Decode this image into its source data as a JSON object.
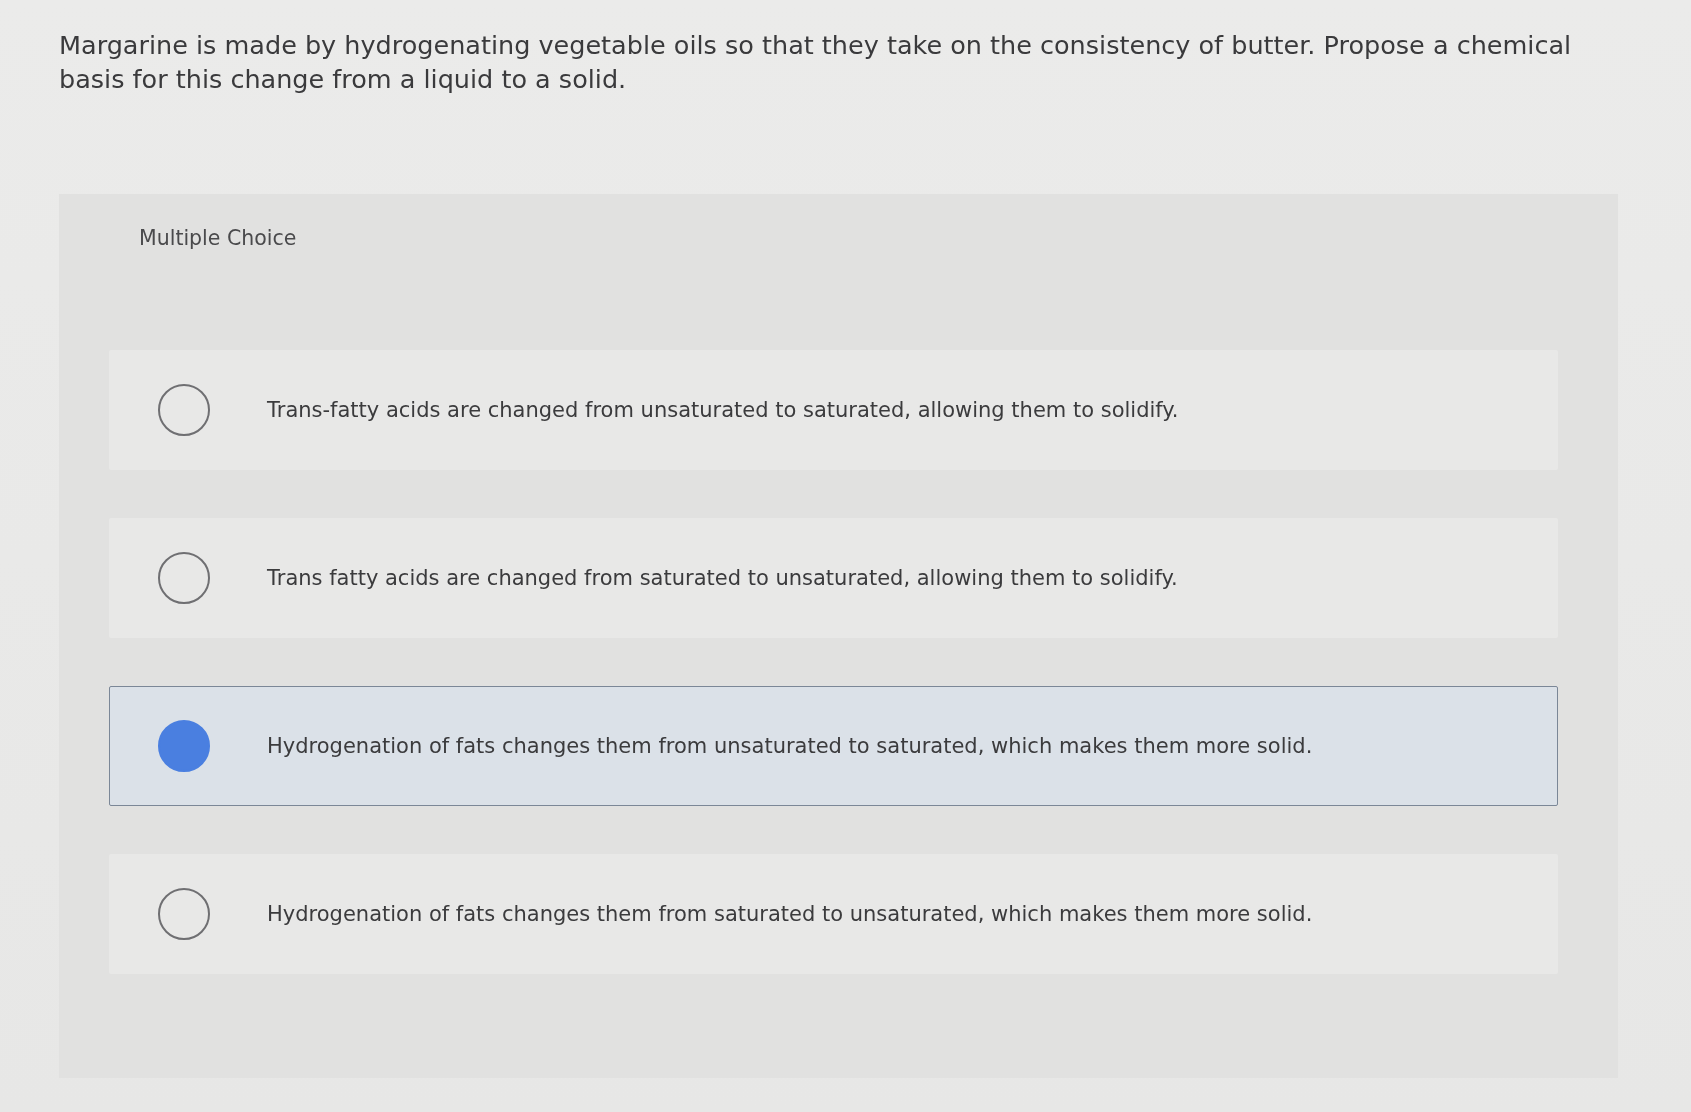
{
  "question": "Margarine is made by hydrogenating vegetable oils so that they take on the consistency of butter. Propose a chemical basis for this change from a liquid to a solid.",
  "panel": {
    "label": "Multiple Choice",
    "options": [
      {
        "text": "Trans-fatty acids are changed from unsaturated to saturated, allowing them to solidify.",
        "selected": false
      },
      {
        "text": "Trans fatty acids are changed from saturated to unsaturated, allowing them to solidify.",
        "selected": false
      },
      {
        "text": "Hydrogenation of fats changes them from unsaturated to saturated, which makes them more solid.",
        "selected": true
      },
      {
        "text": "Hydrogenation of fats changes them from saturated to unsaturated, which makes them more solid.",
        "selected": false
      }
    ]
  }
}
